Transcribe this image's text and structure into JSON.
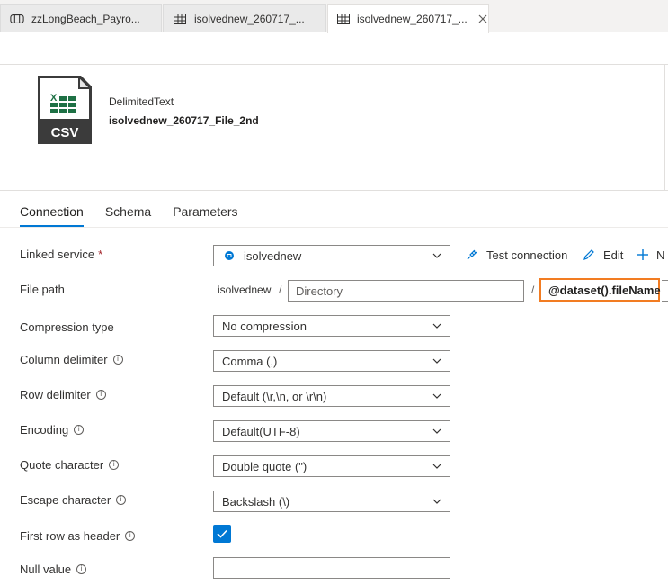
{
  "tabs": [
    {
      "label": "zzLongBeach_Payro...",
      "icon": "pipeline-icon",
      "active": false
    },
    {
      "label": "isolvednew_260717_...",
      "icon": "table-icon",
      "active": false
    },
    {
      "label": "isolvednew_260717_...",
      "icon": "table-icon",
      "active": true
    }
  ],
  "dataset": {
    "type": "DelimitedText",
    "name": "isolvednew_260717_File_2nd",
    "icon_text": "CSV"
  },
  "section_tabs": [
    {
      "label": "Connection",
      "active": true
    },
    {
      "label": "Schema",
      "active": false
    },
    {
      "label": "Parameters",
      "active": false
    }
  ],
  "form": {
    "linked_service": {
      "label": "Linked service",
      "required": "*",
      "value": "isolvednew"
    },
    "actions": {
      "test_connection": "Test connection",
      "edit": "Edit",
      "new": "N"
    },
    "file_path": {
      "label": "File path",
      "container": "isolvednew",
      "separator1": "/",
      "directory_placeholder": "Directory",
      "separator2": "/",
      "file_value": "@dataset().fileName"
    },
    "compression_type": {
      "label": "Compression type",
      "value": "No compression"
    },
    "column_delimiter": {
      "label": "Column delimiter",
      "value": "Comma (,)"
    },
    "row_delimiter": {
      "label": "Row delimiter",
      "value": "Default (\\r,\\n, or \\r\\n)"
    },
    "encoding": {
      "label": "Encoding",
      "value": "Default(UTF-8)"
    },
    "quote_character": {
      "label": "Quote character",
      "value": "Double quote (\")"
    },
    "escape_character": {
      "label": "Escape character",
      "value": "Backslash (\\)"
    },
    "first_row_header": {
      "label": "First row as header",
      "checked": true
    },
    "null_value": {
      "label": "Null value",
      "value": ""
    }
  },
  "colors": {
    "accent": "#0078d4",
    "highlight_border": "#f27c22",
    "required": "#a4262c"
  }
}
